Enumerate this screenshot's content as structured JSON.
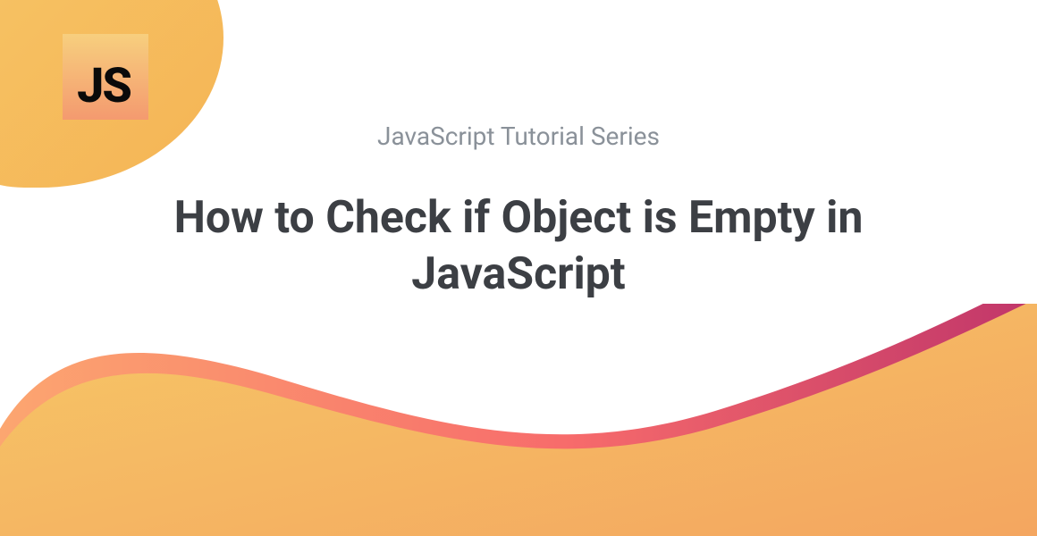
{
  "logo": {
    "text": "JS"
  },
  "subtitle": "JavaScript Tutorial Series",
  "title": "How to Check if Object is Empty in JavaScript"
}
